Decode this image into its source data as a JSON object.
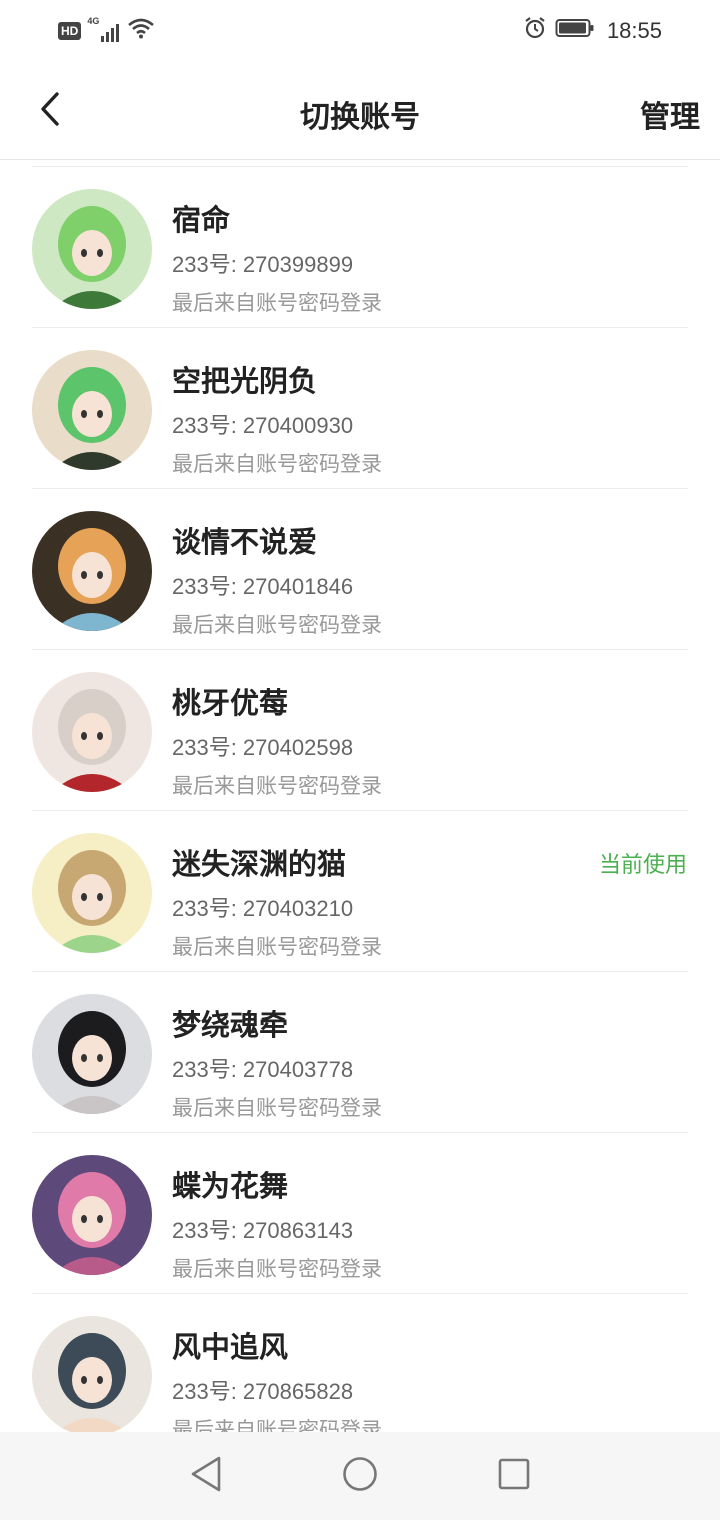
{
  "status_bar": {
    "hd": "HD",
    "network": "4G",
    "time": "18:55",
    "icons": [
      "signal-icon",
      "wifi-icon",
      "alarm-icon",
      "battery-icon"
    ]
  },
  "header": {
    "title": "切换账号",
    "manage": "管理",
    "back_icon": "back-arrow-icon"
  },
  "accounts": [
    {
      "name": "宿命",
      "uid": "233号: 270399899",
      "login": "最后来自账号密码登录",
      "current": "",
      "avatar_colors": [
        "#cfe8c4",
        "#7fcf6a",
        "#3d7a3a"
      ]
    },
    {
      "name": "空把光阴负",
      "uid": "233号: 270400930",
      "login": "最后来自账号密码登录",
      "current": "",
      "avatar_colors": [
        "#e9dcc8",
        "#5cc46a",
        "#2f3a2d"
      ]
    },
    {
      "name": "谈情不说爱",
      "uid": "233号: 270401846",
      "login": "最后来自账号密码登录",
      "current": "",
      "avatar_colors": [
        "#3a3023",
        "#e6a257",
        "#7fb6cf"
      ]
    },
    {
      "name": "桃牙优莓",
      "uid": "233号: 270402598",
      "login": "最后来自账号密码登录",
      "current": "",
      "avatar_colors": [
        "#efe6e2",
        "#d8cfc8",
        "#b3262b"
      ]
    },
    {
      "name": "迷失深渊的猫",
      "uid": "233号: 270403210",
      "login": "最后来自账号密码登录",
      "current": "当前使用",
      "avatar_colors": [
        "#f6eec5",
        "#c8a872",
        "#9bd48a"
      ]
    },
    {
      "name": "梦绕魂牵",
      "uid": "233号: 270403778",
      "login": "最后来自账号密码登录",
      "current": "",
      "avatar_colors": [
        "#dcdde0",
        "#1c1c1f",
        "#c9c4c6"
      ]
    },
    {
      "name": "蝶为花舞",
      "uid": "233号: 270863143",
      "login": "最后来自账号密码登录",
      "current": "",
      "avatar_colors": [
        "#5d4a7a",
        "#e07aa8",
        "#b85a8a"
      ]
    },
    {
      "name": "风中追风",
      "uid": "233号: 270865828",
      "login": "最后来自账号密码登录",
      "current": "",
      "avatar_colors": [
        "#eae6df",
        "#3d4a57",
        "#f1d9c6"
      ]
    }
  ],
  "nav": {
    "back": "nav-back-icon",
    "home": "nav-home-icon",
    "recents": "nav-recents-icon"
  },
  "colors": {
    "current_badge": "#4caf50",
    "primary_text": "#222222",
    "secondary_text": "#666666",
    "tertiary_text": "#999999"
  }
}
